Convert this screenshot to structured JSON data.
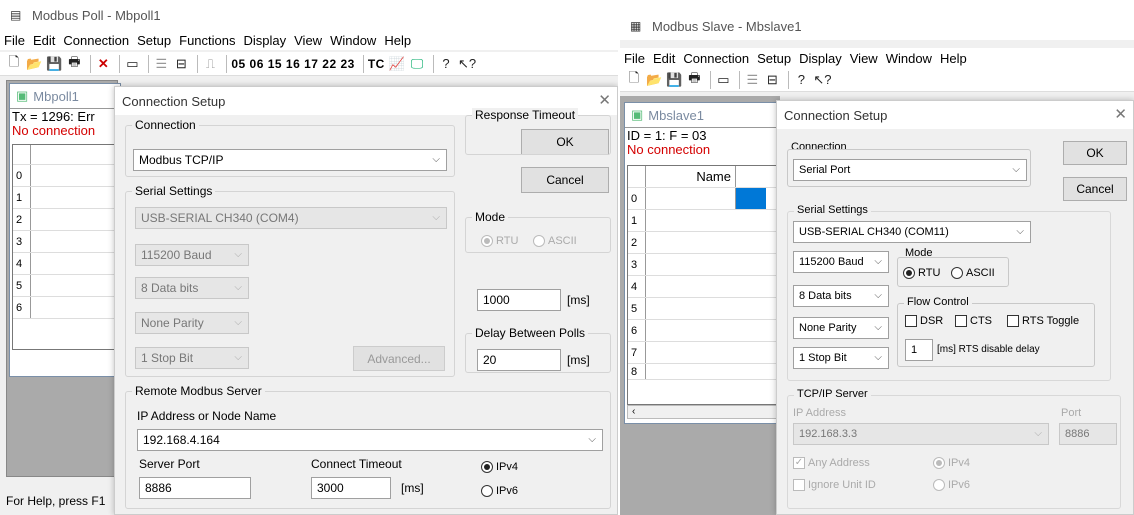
{
  "poll": {
    "title": "Modbus Poll - Mbpoll1",
    "menu": [
      "File",
      "Edit",
      "Connection",
      "Setup",
      "Functions",
      "Display",
      "View",
      "Window",
      "Help"
    ],
    "toolbar_codes": "05 06 15 16 17 22 23",
    "toolbar_tc": "TC",
    "child": {
      "title": "Mbpoll1",
      "line1": "Tx = 1296: Err",
      "line2": "No connection",
      "rows": [
        "0",
        "1",
        "2",
        "3",
        "4",
        "5",
        "6"
      ]
    },
    "status": "For Help, press F1",
    "dialog": {
      "title": "Connection Setup",
      "connection_label": "Connection",
      "connection_value": "Modbus TCP/IP",
      "ok": "OK",
      "cancel": "Cancel",
      "serial_label": "Serial Settings",
      "port": "USB-SERIAL CH340 (COM4)",
      "baud": "115200 Baud",
      "data_bits": "8 Data bits",
      "parity": "None Parity",
      "stop_bit": "1 Stop Bit",
      "advanced": "Advanced...",
      "mode_label": "Mode",
      "mode_rtu": "RTU",
      "mode_ascii": "ASCII",
      "response_label": "Response Timeout",
      "response_value": "1000",
      "response_unit": "[ms]",
      "delay_label": "Delay Between Polls",
      "delay_value": "20",
      "delay_unit": "[ms]",
      "remote_label": "Remote Modbus Server",
      "ip_label": "IP Address or Node Name",
      "ip_value": "192.168.4.164",
      "port_label": "Server Port",
      "port_value": "8886",
      "timeout_label": "Connect Timeout",
      "timeout_value": "3000",
      "timeout_unit": "[ms]",
      "ipv4": "IPv4",
      "ipv6": "IPv6"
    }
  },
  "slave": {
    "title": "Modbus Slave - Mbslave1",
    "menu": [
      "File",
      "Edit",
      "Connection",
      "Setup",
      "Display",
      "View",
      "Window",
      "Help"
    ],
    "child": {
      "title": "Mbslave1",
      "line1": "ID = 1: F = 03",
      "line2": "No connection",
      "name_header": "Name",
      "rows": [
        "0",
        "1",
        "2",
        "3",
        "4",
        "5",
        "6",
        "7",
        "8"
      ]
    },
    "dialog": {
      "title": "Connection Setup",
      "connection_label": "Connection",
      "connection_value": "Serial Port",
      "ok": "OK",
      "cancel": "Cancel",
      "serial_label": "Serial Settings",
      "port": "USB-SERIAL CH340 (COM11)",
      "baud": "115200 Baud",
      "data_bits": "8 Data bits",
      "parity": "None Parity",
      "stop_bit": "1 Stop Bit",
      "mode_label": "Mode",
      "mode_rtu": "RTU",
      "mode_ascii": "ASCII",
      "flow_label": "Flow Control",
      "dsr": "DSR",
      "cts": "CTS",
      "rts_toggle": "RTS Toggle",
      "rts_delay_value": "1",
      "rts_delay_label": "[ms] RTS disable delay",
      "tcp_label": "TCP/IP Server",
      "ip_label": "IP Address",
      "ip_value": "192.168.3.3",
      "port_label": "Port",
      "port_value": "8886",
      "any_address": "Any Address",
      "ignore_unit": "Ignore Unit ID",
      "ipv4": "IPv4",
      "ipv6": "IPv6"
    }
  },
  "colors": {
    "accent_blue": "#0078d7",
    "error_red": "#d40000",
    "mdi_gray": "#aaaaaa"
  }
}
